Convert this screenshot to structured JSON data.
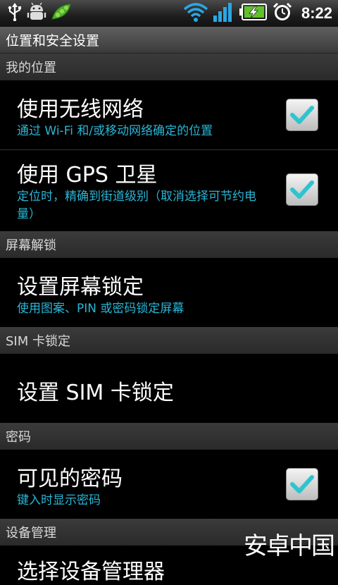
{
  "status_bar": {
    "time": "8:22",
    "left_icons": [
      "usb-icon",
      "android-debug-icon",
      "peapod-app-icon"
    ],
    "right_icons": [
      "wifi-icon",
      "signal-icon",
      "battery-charging-icon",
      "alarm-clock-icon"
    ]
  },
  "title": "位置和安全设置",
  "sections": {
    "location": "我的位置",
    "screen_unlock": "屏幕解锁",
    "sim_lock": "SIM 卡锁定",
    "passwords": "密码",
    "device_admin": "设备管理"
  },
  "items": {
    "wireless": {
      "title": "使用无线网络",
      "summary": "通过 Wi-Fi 和/或移动网络确定的位置",
      "checked": true
    },
    "gps": {
      "title": "使用 GPS 卫星",
      "summary": "定位时，精确到街道级别（取消选择可节约电量）",
      "checked": true
    },
    "screen_lock": {
      "title": "设置屏幕锁定",
      "summary": "使用图案、PIN 或密码锁定屏幕"
    },
    "sim_lock": {
      "title": "设置 SIM 卡锁定"
    },
    "visible_password": {
      "title": "可见的密码",
      "summary": "键入时显示密码",
      "checked": true
    },
    "device_admins": {
      "title": "选择设备管理器"
    }
  },
  "watermark": "安卓中国",
  "colors": {
    "summary": "#29b6d6",
    "check": "#2ec4cf"
  }
}
